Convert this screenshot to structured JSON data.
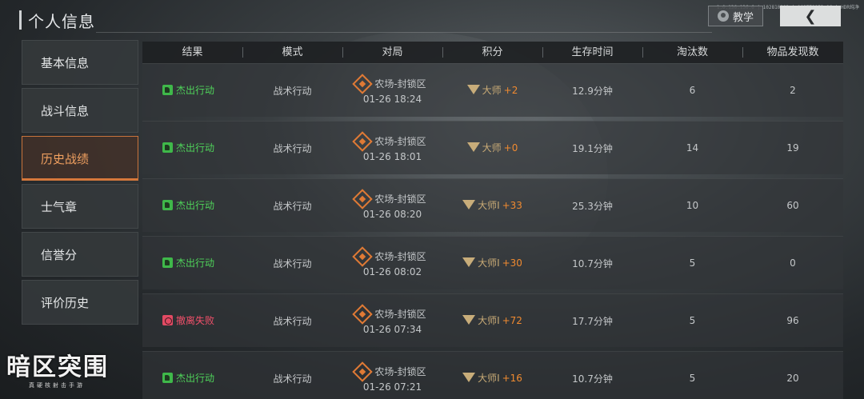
{
  "header": {
    "title": "个人信息",
    "version": "1.0.136.136.6 | 102810202 | 103778853 16 | HDR纯净",
    "tutorial_label": "教学",
    "back_icon": "chevron-left-icon"
  },
  "sidebar": {
    "items": [
      {
        "label": "基本信息",
        "active": false
      },
      {
        "label": "战斗信息",
        "active": false
      },
      {
        "label": "历史战绩",
        "active": true
      },
      {
        "label": "士气章",
        "active": false
      },
      {
        "label": "信誉分",
        "active": false
      },
      {
        "label": "评价历史",
        "active": false
      }
    ]
  },
  "table": {
    "columns": [
      "结果",
      "模式",
      "对局",
      "积分",
      "生存时间",
      "淘汰数",
      "物品发现数"
    ],
    "rows": [
      {
        "result": "杰出行动",
        "result_type": "win",
        "mode": "战术行动",
        "map": "农场-封锁区",
        "time": "01-26 18:24",
        "rank": "大师",
        "delta": "+2",
        "survival": "12.9分钟",
        "kills": "6",
        "items": "2"
      },
      {
        "result": "杰出行动",
        "result_type": "win",
        "mode": "战术行动",
        "map": "农场-封锁区",
        "time": "01-26 18:01",
        "rank": "大师",
        "delta": "+0",
        "survival": "19.1分钟",
        "kills": "14",
        "items": "19"
      },
      {
        "result": "杰出行动",
        "result_type": "win",
        "mode": "战术行动",
        "map": "农场-封锁区",
        "time": "01-26 08:20",
        "rank": "大师I",
        "delta": "+33",
        "survival": "25.3分钟",
        "kills": "10",
        "items": "60"
      },
      {
        "result": "杰出行动",
        "result_type": "win",
        "mode": "战术行动",
        "map": "农场-封锁区",
        "time": "01-26 08:02",
        "rank": "大师I",
        "delta": "+30",
        "survival": "10.7分钟",
        "kills": "5",
        "items": "0"
      },
      {
        "result": "撤离失败",
        "result_type": "fail",
        "mode": "战术行动",
        "map": "农场-封锁区",
        "time": "01-26 07:34",
        "rank": "大师I",
        "delta": "+72",
        "survival": "17.7分钟",
        "kills": "5",
        "items": "96"
      },
      {
        "result": "杰出行动",
        "result_type": "win",
        "mode": "战术行动",
        "map": "农场-封锁区",
        "time": "01-26 07:21",
        "rank": "大师I",
        "delta": "+16",
        "survival": "10.7分钟",
        "kills": "5",
        "items": "20"
      }
    ]
  },
  "logo": {
    "main": "暗区突围",
    "sub": "真硬核射击手游"
  }
}
